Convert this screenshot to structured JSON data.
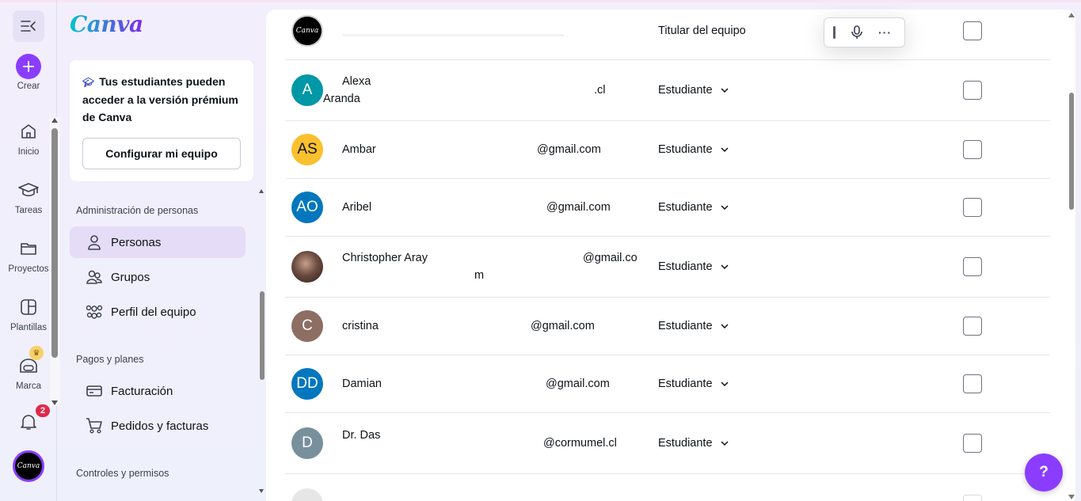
{
  "rail": {
    "create_label": "Crear",
    "items": [
      {
        "label": "Inicio",
        "icon": "home-icon"
      },
      {
        "label": "Tareas",
        "icon": "graduation-cap-icon"
      },
      {
        "label": "Proyectos",
        "icon": "folder-icon"
      },
      {
        "label": "Plantillas",
        "icon": "templates-icon"
      },
      {
        "label": "Marca",
        "icon": "brand-icon"
      }
    ],
    "notification_count": "2",
    "user_avatar_text": "Canva"
  },
  "sidebar": {
    "logo": "Canva",
    "promo_text": "Tus estudiantes pueden acceder a la versión prémium de Canva",
    "promo_button": "Configurar mi equipo",
    "section_people": "Administración de personas",
    "people_items": [
      "Personas",
      "Grupos",
      "Perfil del equipo"
    ],
    "section_billing": "Pagos y planes",
    "billing_items": [
      "Facturación",
      "Pedidos y facturas"
    ],
    "section_controls": "Controles y permisos"
  },
  "members": [
    {
      "initials": "Canva",
      "name": "",
      "name_line2": "",
      "email": "",
      "role": "Titular del equipo",
      "color": "#000000"
    },
    {
      "initials": "A",
      "name": "Alexa",
      "name_line2": "Aranda",
      "email": ".cl",
      "role": "Estudiante",
      "color": "#0097a7"
    },
    {
      "initials": "AS",
      "name": "Ambar",
      "name_line2": "",
      "email": "@gmail.com",
      "role": "Estudiante",
      "color": "#fbc02d"
    },
    {
      "initials": "AO",
      "name": "Aribel",
      "name_line2": "",
      "email": "@gmail.com",
      "role": "Estudiante",
      "color": "#0277bd"
    },
    {
      "initials": "",
      "name": "Christopher Aray",
      "name_line2": "",
      "email": "@gmail.co",
      "email_line2": "m",
      "role": "Estudiante",
      "color": "#5d4037"
    },
    {
      "initials": "C",
      "name": "cristina",
      "name_line2": "",
      "email": "@gmail.com",
      "role": "Estudiante",
      "color": "#8d6e63"
    },
    {
      "initials": "DD",
      "name": "Damian",
      "name_line2": "",
      "email": "@gmail.com",
      "role": "Estudiante",
      "color": "#0277bd"
    },
    {
      "initials": "D",
      "name": "Dr. Das",
      "name_line2": "",
      "email": "@cormumel.cl",
      "role": "Estudiante",
      "color": "#78909c"
    }
  ],
  "help_label": "?",
  "toolbar": {
    "more_label": "···"
  }
}
